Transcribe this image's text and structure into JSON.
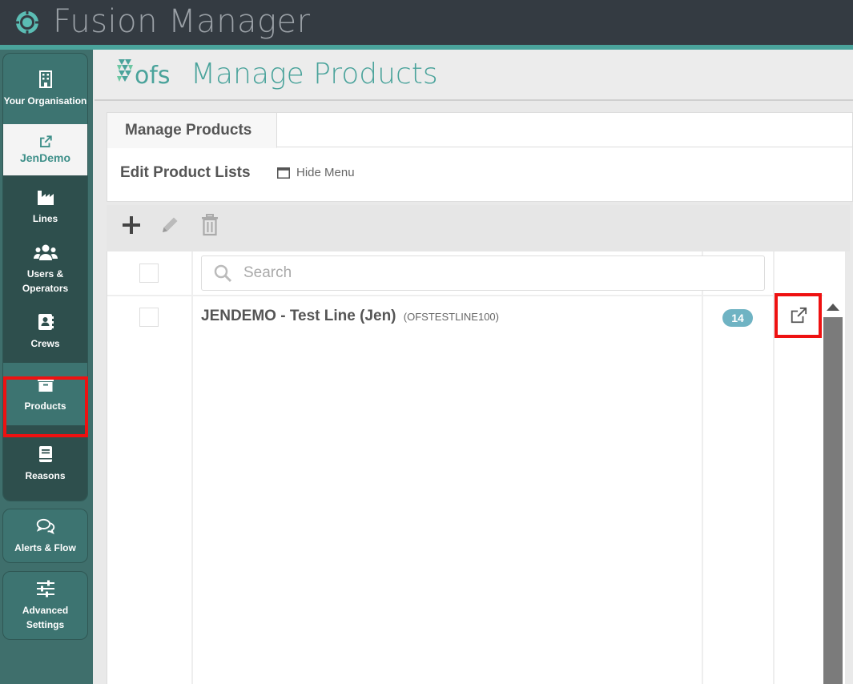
{
  "app": {
    "title": "Fusion Manager"
  },
  "header": {
    "title": "Manage Products",
    "logo_text": "ofs"
  },
  "sidebar": {
    "items": [
      {
        "label": "Your Organisation",
        "icon": "building-icon"
      },
      {
        "label": "JenDemo",
        "icon": "external-link-icon"
      },
      {
        "label": "Lines",
        "icon": "factory-icon"
      },
      {
        "label": "Users & Operators",
        "icon": "users-icon"
      },
      {
        "label": "Crews",
        "icon": "address-book-icon"
      },
      {
        "label": "Products",
        "icon": "archive-box-icon"
      },
      {
        "label": "Reasons",
        "icon": "book-icon"
      },
      {
        "label": "Alerts & Flow",
        "icon": "chat-bubbles-icon"
      },
      {
        "label": "Advanced Settings",
        "icon": "sliders-icon"
      }
    ]
  },
  "panel": {
    "tab_label": "Manage Products",
    "section_title": "Edit Product Lists",
    "hide_menu_label": "Hide Menu"
  },
  "table": {
    "search_placeholder": "Search",
    "rows": [
      {
        "name": "JENDEMO - Test Line (Jen)",
        "code": "(OFSTESTLINE100)",
        "count": "14"
      }
    ]
  },
  "colors": {
    "accent": "#4aa39b",
    "topbar": "#343b42",
    "sidebar": "#3f6f6c",
    "badge": "#6fb3c3",
    "highlight": "#ee1111"
  }
}
